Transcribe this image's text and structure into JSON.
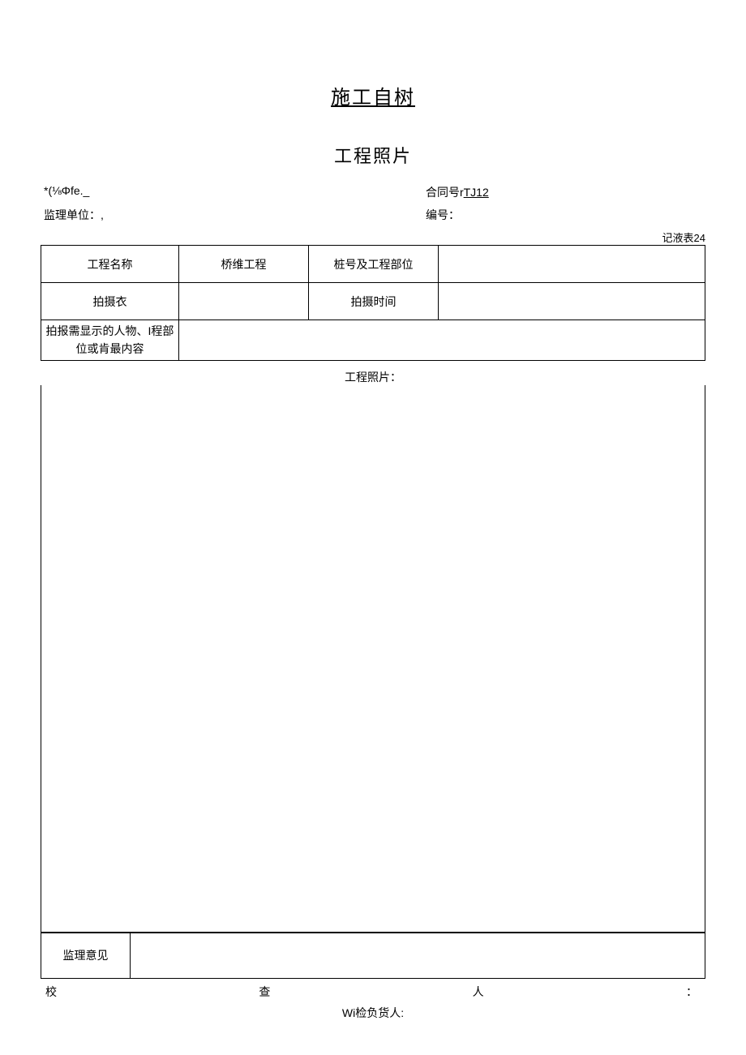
{
  "titles": {
    "main": "施工自树",
    "sub": "工程照片"
  },
  "meta": {
    "left1": "*(⅛Φfe._",
    "right1_label": "合同号r",
    "right1_value": "TJ12",
    "left2": "监理单位：,",
    "right2": "编号：",
    "record": "记液表24"
  },
  "table": {
    "r1c1": "工程名称",
    "r1c2": "桥维工程",
    "r1c3": "桩号及工程部位",
    "r1c4": "",
    "r2c1": "拍摄衣",
    "r2c2": "",
    "r2c3": "拍摄时间",
    "r2c4": "",
    "r3c1": "拍报需显示的人物、I程部位或肯最内容",
    "r3c2": ""
  },
  "photo": {
    "label": "工程照片："
  },
  "opinion": {
    "label": "监理意见",
    "value": ""
  },
  "footer": {
    "a": "校",
    "b": "查",
    "c": "人",
    "d": "：",
    "center": "Wi检负货人:"
  }
}
